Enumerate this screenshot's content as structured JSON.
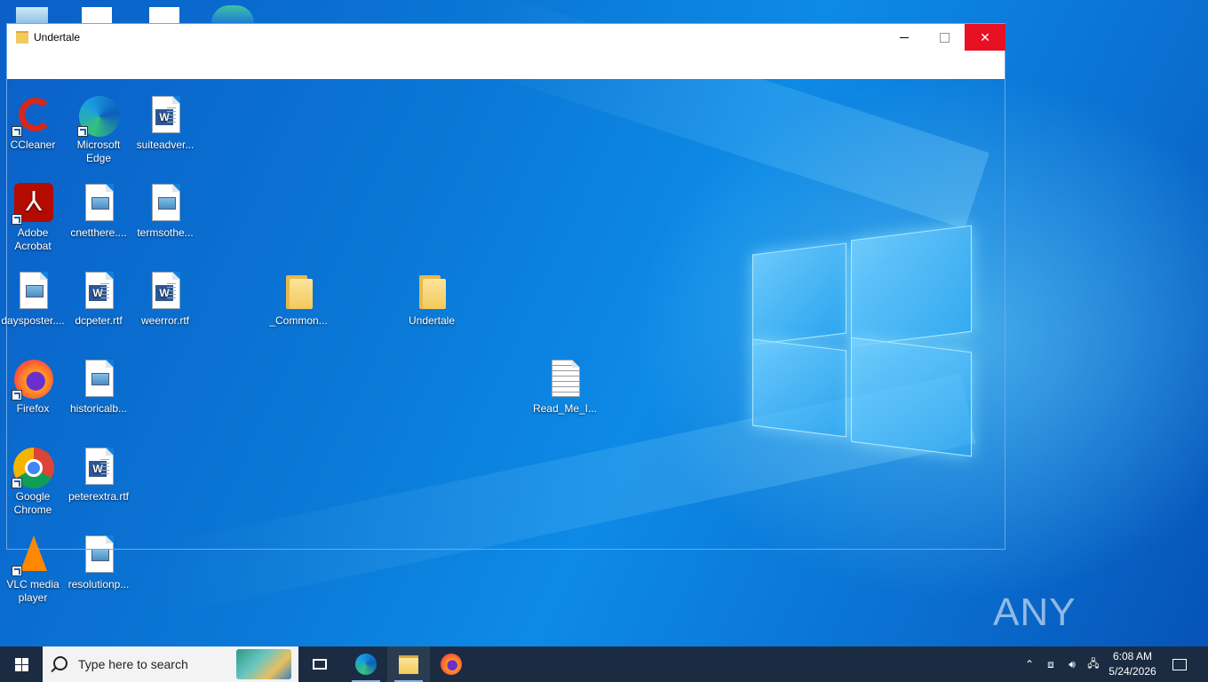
{
  "window": {
    "title": "Undertale",
    "minimize": "Minimize",
    "maximize": "Maximize",
    "close": "Close"
  },
  "desktop_icons": [
    {
      "name": "ccleaner",
      "label": "CCleaner"
    },
    {
      "name": "edge",
      "label": "Microsoft Edge"
    },
    {
      "name": "suiteadver",
      "label": "suiteadver..."
    },
    {
      "name": "acrobat",
      "label": "Adobe Acrobat"
    },
    {
      "name": "cnetthere",
      "label": "cnetthere...."
    },
    {
      "name": "termsothe",
      "label": "termsothe..."
    },
    {
      "name": "daysposter",
      "label": "daysposter...."
    },
    {
      "name": "dcpeter",
      "label": "dcpeter.rtf"
    },
    {
      "name": "weerror",
      "label": "weerror.rtf"
    },
    {
      "name": "common",
      "label": "_Common..."
    },
    {
      "name": "undertale",
      "label": "Undertale"
    },
    {
      "name": "firefox",
      "label": "Firefox"
    },
    {
      "name": "historicalb",
      "label": "historicalb..."
    },
    {
      "name": "readme",
      "label": "Read_Me_I..."
    },
    {
      "name": "chrome",
      "label": "Google Chrome"
    },
    {
      "name": "peterextra",
      "label": "peterextra.rtf"
    },
    {
      "name": "vlc",
      "label": "VLC media player"
    },
    {
      "name": "resolutionp",
      "label": "resolutionp..."
    }
  ],
  "taskbar": {
    "search_placeholder": "Type here to search",
    "time": "6:08 AM",
    "date": "5/24/2026"
  },
  "watermark": "ANY RUN",
  "colors": {
    "close_red": "#e81123",
    "taskbar": "#1b2c42"
  }
}
